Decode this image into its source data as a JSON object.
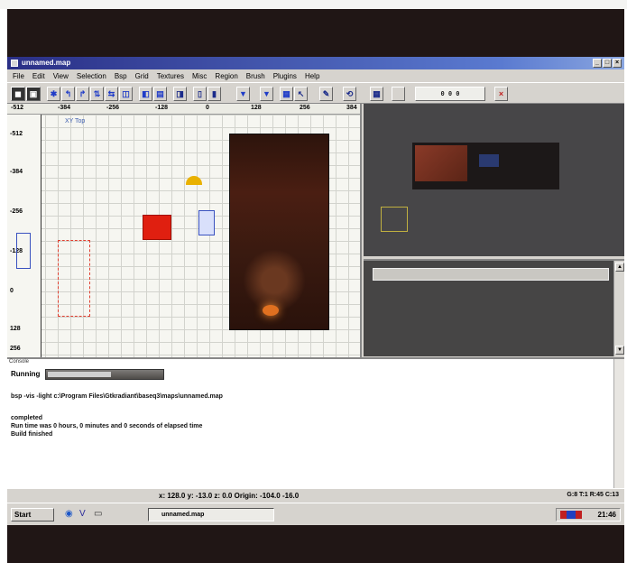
{
  "window": {
    "title": "unnamed.map"
  },
  "window_controls": [
    "_",
    "□",
    "×"
  ],
  "menu": [
    "File",
    "Edit",
    "View",
    "Selection",
    "Bsp",
    "Grid",
    "Textures",
    "Misc",
    "Region",
    "Brush",
    "Plugins",
    "Help"
  ],
  "toolbar": {
    "buttons": [
      "◼",
      "▣",
      "✱",
      "↰",
      "↱",
      "⇅",
      "⇆",
      "◫",
      "◧",
      "▤",
      "◨",
      "▯",
      "▮",
      "▼",
      "▼",
      "▦",
      "↖",
      "✎",
      "⟲",
      "▦"
    ],
    "grid_readout": "0 0 0",
    "close_glyph": "×"
  },
  "xy_view": {
    "label": "XY Top",
    "ruler_top": [
      "-512",
      "-384",
      "-256",
      "-128",
      "0",
      "128",
      "256",
      "384"
    ],
    "ruler_left": [
      "-512",
      "-384",
      "-256",
      "-128",
      "0",
      "128",
      "256"
    ]
  },
  "console": {
    "tab_label": "Console",
    "progress_label": "Running",
    "lines": [
      "bsp -vis -light c:\\Program Files\\Gtkradiant\\baseq3\\maps\\unnamed.map",
      "completed",
      "Run time was 0 hours, 0 minutes and 0 seconds of elapsed time",
      "Build finished"
    ],
    "progress": 0.55
  },
  "status": {
    "coords": "x: 128.0  y: -13.0  z: 0.0  Origin: -104.0  -16.0",
    "right": "G:8 T:1 R:45 C:13"
  },
  "taskbar": {
    "start": "Start",
    "task": "unnamed.map",
    "clock": "21:46"
  },
  "colors": {
    "title_gradient_start": "#2a2f86",
    "red_brush": "#e01f10",
    "window_face": "#d6d3ce"
  }
}
